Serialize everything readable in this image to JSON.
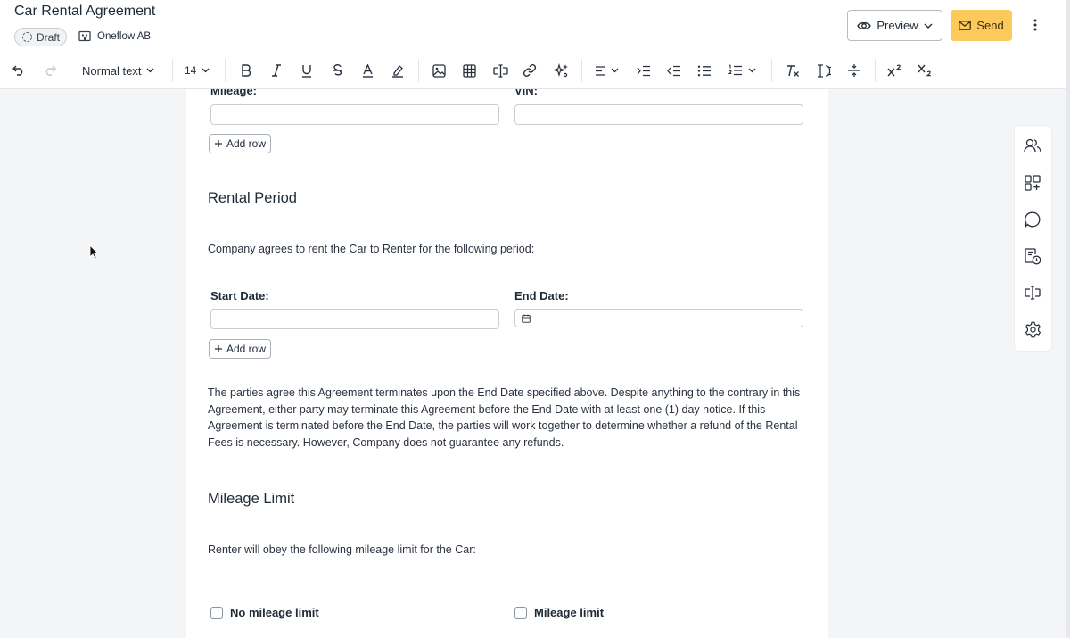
{
  "header": {
    "title": "Car Rental Agreement",
    "status_badge": "Draft",
    "company": "Oneflow AB",
    "preview_label": "Preview",
    "send_label": "Send"
  },
  "toolbar": {
    "text_style": "Normal text",
    "font_size": "14"
  },
  "document": {
    "mileage_label": "Mileage:",
    "vin_label": "VIN:",
    "add_row_1": "Add row",
    "rental_period_heading": "Rental Period",
    "rental_period_intro": "Company agrees to rent the Car to Renter for the following period:",
    "start_date_label": "Start Date:",
    "end_date_label": "End Date:",
    "add_row_2": "Add row",
    "termination_text": "The parties agree this Agreement terminates upon the End Date specified above. Despite anything to the contrary in this Agreement, either party may terminate this Agreement before the End Date with at least one (1) day notice. If this Agreement is terminated before the End Date, the parties will work together to determine whether a refund of the Rental Fees is necessary. However, Company does not guarantee any refunds.",
    "mileage_limit_heading": "Mileage Limit",
    "mileage_limit_intro": "Renter will obey the following mileage limit for the Car:",
    "no_mileage_limit_label": "No mileage limit",
    "mileage_limit_label": "Mileage limit"
  },
  "colors": {
    "send_button": "#fcc95a",
    "page_background": "#f4f5f6",
    "paper": "#ffffff"
  }
}
